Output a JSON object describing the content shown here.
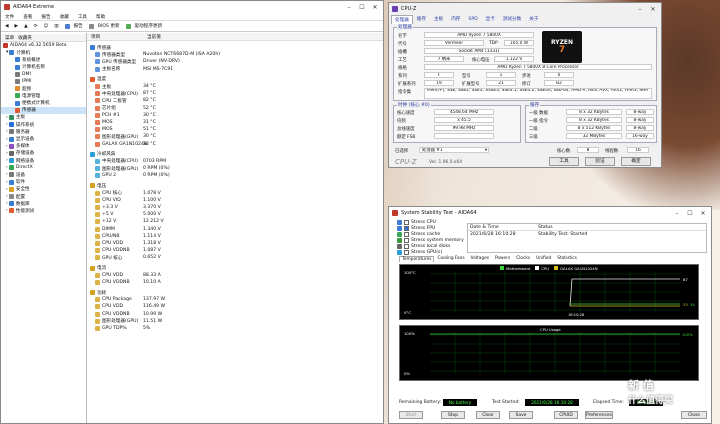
{
  "aida": {
    "title": "AIDA64 Extreme",
    "menu": [
      "文件",
      "查看",
      "报告",
      "收藏",
      "工具",
      "帮助"
    ],
    "toolbar": [
      "报告",
      "BIOS 更新",
      "驱动程序更新"
    ],
    "tree_header": [
      "菜单",
      "收藏夹"
    ],
    "tree": [
      "AIDA64 v6.32.5659 Beta",
      "计算机",
      "系统概述",
      "计算机名称",
      "DMI",
      "IPMI",
      "超频",
      "电源管理",
      "便携式计算机",
      "传感器",
      "主板",
      "操作系统",
      "服务器",
      "显示设备",
      "多媒体",
      "存储设备",
      "网络设备",
      "DirectX",
      "设备",
      "软件",
      "安全性",
      "配置",
      "数据库",
      "性能测试"
    ],
    "col_headers": [
      "项目",
      "当前值"
    ],
    "sections": [
      {
        "title": "传感器",
        "rows": [
          [
            "传感器类型",
            "Nuvoton NCT6687D-M (ISA A20h)"
          ],
          [
            "GPU 传感器类型",
            "Driver (NV-DRV)"
          ],
          [
            "主板名称",
            "MSI MS-7C91"
          ]
        ]
      },
      {
        "title": "温度",
        "rows": [
          [
            "主板",
            "34 °C"
          ],
          [
            "中央处理器(CPU)",
            "87 °C"
          ],
          [
            "CPU 二极管",
            "82 °C"
          ],
          [
            "芯片组",
            "52 °C"
          ],
          [
            "PCH #1",
            "30 °C"
          ],
          [
            "MOS",
            "31 °C"
          ],
          [
            "MOS",
            "51 °C"
          ],
          [
            "图形处理器(GPU)",
            "30 °C"
          ],
          [
            "GALAX GA1N1024N",
            "33 °C"
          ]
        ]
      },
      {
        "title": "冷却风扇",
        "rows": [
          [
            "中央处理器(CPU)",
            "0703 RPM"
          ],
          [
            "图形处理器(GPU)",
            "0 RPM  (0%)"
          ],
          [
            "GPU 2",
            "0 RPM  (0%)"
          ]
        ]
      },
      {
        "title": "电压",
        "rows": [
          [
            "CPU 核心",
            "1.078 V"
          ],
          [
            "CPU VID",
            "1.100 V"
          ],
          [
            "+3.3 V",
            "3.370 V"
          ],
          [
            "+5 V",
            "5.000 V"
          ],
          [
            "+12 V",
            "12.212 V"
          ],
          [
            "DIMM",
            "1.340 V"
          ],
          [
            "CPU/NB",
            "1.114 V"
          ],
          [
            "CPU VDD",
            "1.318 V"
          ],
          [
            "CPU VDDNB",
            "1.087 V"
          ],
          [
            "GPU 核心",
            "0.652 V"
          ]
        ]
      },
      {
        "title": "电流",
        "rows": [
          [
            "CPU VDD",
            "88.33 A"
          ],
          [
            "CPU VDDNB",
            "10.10 A"
          ]
        ]
      },
      {
        "title": "功耗",
        "rows": [
          [
            "CPU Package",
            "137.97 W"
          ],
          [
            "CPU VDD",
            "116.49 W"
          ],
          [
            "CPU VDDNB",
            "10.99 W"
          ],
          [
            "图形处理器(GPU)",
            "11.51 W"
          ],
          [
            "GPU TDP%",
            "5%"
          ]
        ]
      }
    ]
  },
  "cpuz": {
    "title": "CPU-Z",
    "tabs": [
      "处理器",
      "缓存",
      "主板",
      "内存",
      "SPD",
      "显卡",
      "测试分数",
      "关于"
    ],
    "group_processor": "处理器",
    "name_label": "名字",
    "name": "AMD Ryzen 7 5800X",
    "codename_label": "代号",
    "codename": "Vermeer",
    "tdp_label": "TDP",
    "tdp": "105.0 W",
    "package_label": "插槽",
    "package": "Socket AM4 (1331)",
    "tech_label": "工艺",
    "tech": "7 纳米",
    "voltage_label": "核心电压",
    "voltage": "1.122 V",
    "spec_label": "规格",
    "spec": "AMD Ryzen 7 5800X 8-Core Processor",
    "family_label": "系列",
    "family": "F",
    "model_label": "型号",
    "model": "1",
    "stepping_label": "步进",
    "stepping": "0",
    "extfamily_label": "扩展系列",
    "extfamily": "19",
    "extmodel_label": "扩展型号",
    "extmodel": "21",
    "revision_label": "修订",
    "revision": "B2",
    "instr_label": "指令集",
    "instr": "MMX(+), SSE, SSE2, SSE3, SSSE3, SSE4.1, SSE4.2, SSE4A, x86-64, AMD-V, AES, AVX, AVX2, FMA3, SHA",
    "group_clocks": "时钟 (核心 #0)",
    "core_speed_label": "核心速度",
    "core_speed": "4548.64 MHz",
    "mult_label": "倍频",
    "mult": "x 45.5",
    "bus_label": "总线速度",
    "bus": "99.98 MHz",
    "fsb_label": "额定 FSB",
    "fsb": "",
    "group_cache": "缓存",
    "cache_rows": [
      [
        "一级 数据",
        "8 x 32 KBytes",
        "8-way"
      ],
      [
        "一级 指令",
        "8 x 32 KBytes",
        "8-way"
      ],
      [
        "二级",
        "8 x 512 KBytes",
        "8-way"
      ],
      [
        "三级",
        "32 MBytes",
        "16-way"
      ]
    ],
    "sel_label": "已选择",
    "sel_value": "处理器 #1",
    "cores_label": "核心数",
    "cores": "8",
    "threads_label": "线程数",
    "threads": "16",
    "version": "Ver. 1.96.0.x64",
    "tools_btn": "工具",
    "validate_btn": "验证",
    "ok_btn": "确定",
    "logo_brand": "RYZEN",
    "logo_num": "7"
  },
  "stab": {
    "title": "System Stability Test - AIDA64",
    "checks": [
      [
        "Stress CPU",
        false
      ],
      [
        "Stress FPU",
        true
      ],
      [
        "Stress cache",
        false
      ],
      [
        "Stress system memory",
        false
      ],
      [
        "Stress local disks",
        false
      ],
      [
        "Stress GPU(s)",
        false
      ]
    ],
    "table_headers": [
      "Date & Time",
      "Status"
    ],
    "table_row": [
      "2021/6/28 16:10:28",
      "Stability Test: Started"
    ],
    "tabs": [
      "Temperatures",
      "Cooling Fans",
      "Voltages",
      "Powers",
      "Clocks",
      "Unified",
      "Statistics"
    ],
    "legend": [
      "Motherboard",
      "CPU",
      "GALAX GA1N1024N"
    ],
    "temp_graph": {
      "y_top": "100°C",
      "y_bottom": "0°C",
      "time": "16:10:28",
      "right_values": [
        "87",
        "33",
        "34"
      ]
    },
    "cpu_graph": {
      "title": "CPU Usage",
      "y_top": "100%",
      "y_bottom": "0%",
      "right_value": "100%"
    },
    "remaining_label": "Remaining Battery:",
    "remaining": "No battery",
    "started_label": "Test Started:",
    "started": "2021/6/28 16:10:28",
    "elapsed_label": "Elapsed Time:",
    "elapsed": "00:02:50",
    "buttons": [
      "Start",
      "Stop",
      "Clear",
      "Save",
      "CPUID",
      "Preferences",
      "Close"
    ]
  },
  "watermark": [
    "新",
    "值",
    "什么值得买"
  ]
}
